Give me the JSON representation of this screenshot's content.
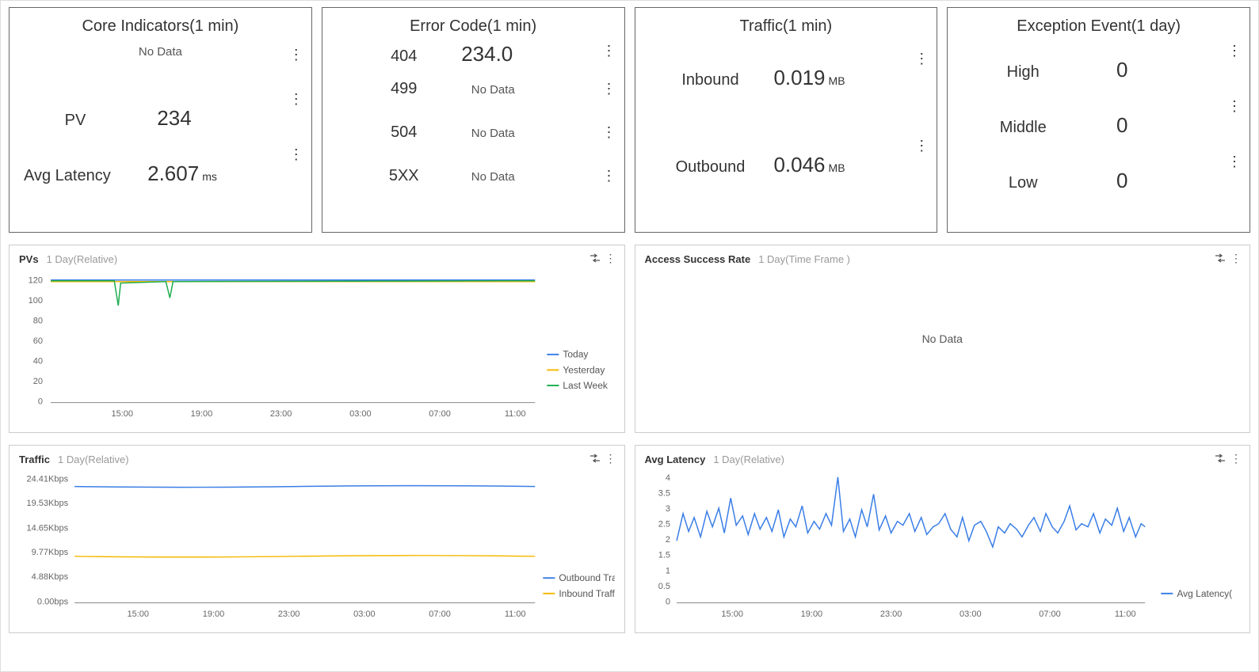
{
  "cards": {
    "core": {
      "title": "Core Indicators(1 min)",
      "no_data": "No Data",
      "pv_label": "PV",
      "pv_value": "234",
      "latency_label": "Avg Latency",
      "latency_value": "2.607",
      "latency_unit": "ms"
    },
    "error": {
      "title": "Error Code(1 min)",
      "r404_label": "404",
      "r404_value": "234.0",
      "r499_label": "499",
      "no_data_499": "No Data",
      "r504_label": "504",
      "no_data_504": "No Data",
      "r5xx_label": "5XX",
      "no_data_5xx": "No Data"
    },
    "traffic": {
      "title": "Traffic(1 min)",
      "in_label": "Inbound",
      "in_value": "0.019",
      "in_unit": "MB",
      "out_label": "Outbound",
      "out_value": "0.046",
      "out_unit": "MB"
    },
    "exception": {
      "title": "Exception Event(1 day)",
      "high_label": "High",
      "high_value": "0",
      "mid_label": "Middle",
      "mid_value": "0",
      "low_label": "Low",
      "low_value": "0"
    }
  },
  "charts": {
    "pvs": {
      "title": "PVs",
      "subtitle": "1 Day(Relative)",
      "legend": [
        "Today",
        "Yesterday",
        "Last Week"
      ],
      "x_ticks": [
        "15:00",
        "19:00",
        "23:00",
        "03:00",
        "07:00",
        "11:00"
      ],
      "y_ticks": [
        "0",
        "20",
        "40",
        "60",
        "80",
        "100",
        "120"
      ]
    },
    "success": {
      "title": "Access Success Rate",
      "subtitle": "1 Day(Time Frame )",
      "no_data": "No Data"
    },
    "traffic": {
      "title": "Traffic",
      "subtitle": "1 Day(Relative)",
      "legend": [
        "Outbound Tra",
        "Inbound Traff"
      ],
      "x_ticks": [
        "15:00",
        "19:00",
        "23:00",
        "03:00",
        "07:00",
        "11:00"
      ],
      "y_ticks": [
        "0.00bps",
        "4.88Kbps",
        "9.77Kbps",
        "14.65Kbps",
        "19.53Kbps",
        "24.41Kbps"
      ]
    },
    "latency": {
      "title": "Avg Latency",
      "subtitle": "1 Day(Relative)",
      "legend": [
        "Avg Latency("
      ],
      "x_ticks": [
        "15:00",
        "19:00",
        "23:00",
        "03:00",
        "07:00",
        "11:00"
      ],
      "y_ticks": [
        "0",
        "0.5",
        "1",
        "1.5",
        "2",
        "2.5",
        "3",
        "3.5",
        "4"
      ]
    }
  },
  "chart_data": [
    {
      "type": "line",
      "title": "PVs",
      "xlabel": "",
      "ylabel": "",
      "ylim": [
        0,
        120
      ],
      "categories": [
        "15:00",
        "19:00",
        "23:00",
        "03:00",
        "07:00",
        "11:00"
      ],
      "series": [
        {
          "name": "Today",
          "values": [
            118,
            117,
            118,
            117,
            118,
            117
          ]
        },
        {
          "name": "Yesterday",
          "values": [
            117,
            118,
            117,
            118,
            117,
            118
          ]
        },
        {
          "name": "Last Week",
          "values": [
            117,
            100,
            118,
            117,
            117,
            118
          ]
        }
      ]
    },
    {
      "type": "line",
      "title": "Access Success Rate",
      "xlabel": "",
      "ylabel": "",
      "series": []
    },
    {
      "type": "line",
      "title": "Traffic",
      "xlabel": "",
      "ylabel": "",
      "ylim_kbps": [
        0,
        24.41
      ],
      "categories": [
        "15:00",
        "19:00",
        "23:00",
        "03:00",
        "07:00",
        "11:00"
      ],
      "series": [
        {
          "name": "Outbound Tra",
          "values_kbps": [
            23.5,
            23.4,
            23.6,
            23.5,
            23.4,
            23.5
          ]
        },
        {
          "name": "Inbound Traff",
          "values_kbps": [
            9.6,
            9.5,
            9.6,
            9.6,
            9.5,
            9.6
          ]
        }
      ]
    },
    {
      "type": "line",
      "title": "Avg Latency",
      "xlabel": "",
      "ylabel": "",
      "ylim": [
        0,
        4
      ],
      "categories": [
        "15:00",
        "19:00",
        "23:00",
        "03:00",
        "07:00",
        "11:00"
      ],
      "series": [
        {
          "name": "Avg Latency(",
          "values": [
            2.1,
            2.6,
            2.4,
            2.8,
            2.5,
            2.7
          ]
        }
      ]
    }
  ]
}
